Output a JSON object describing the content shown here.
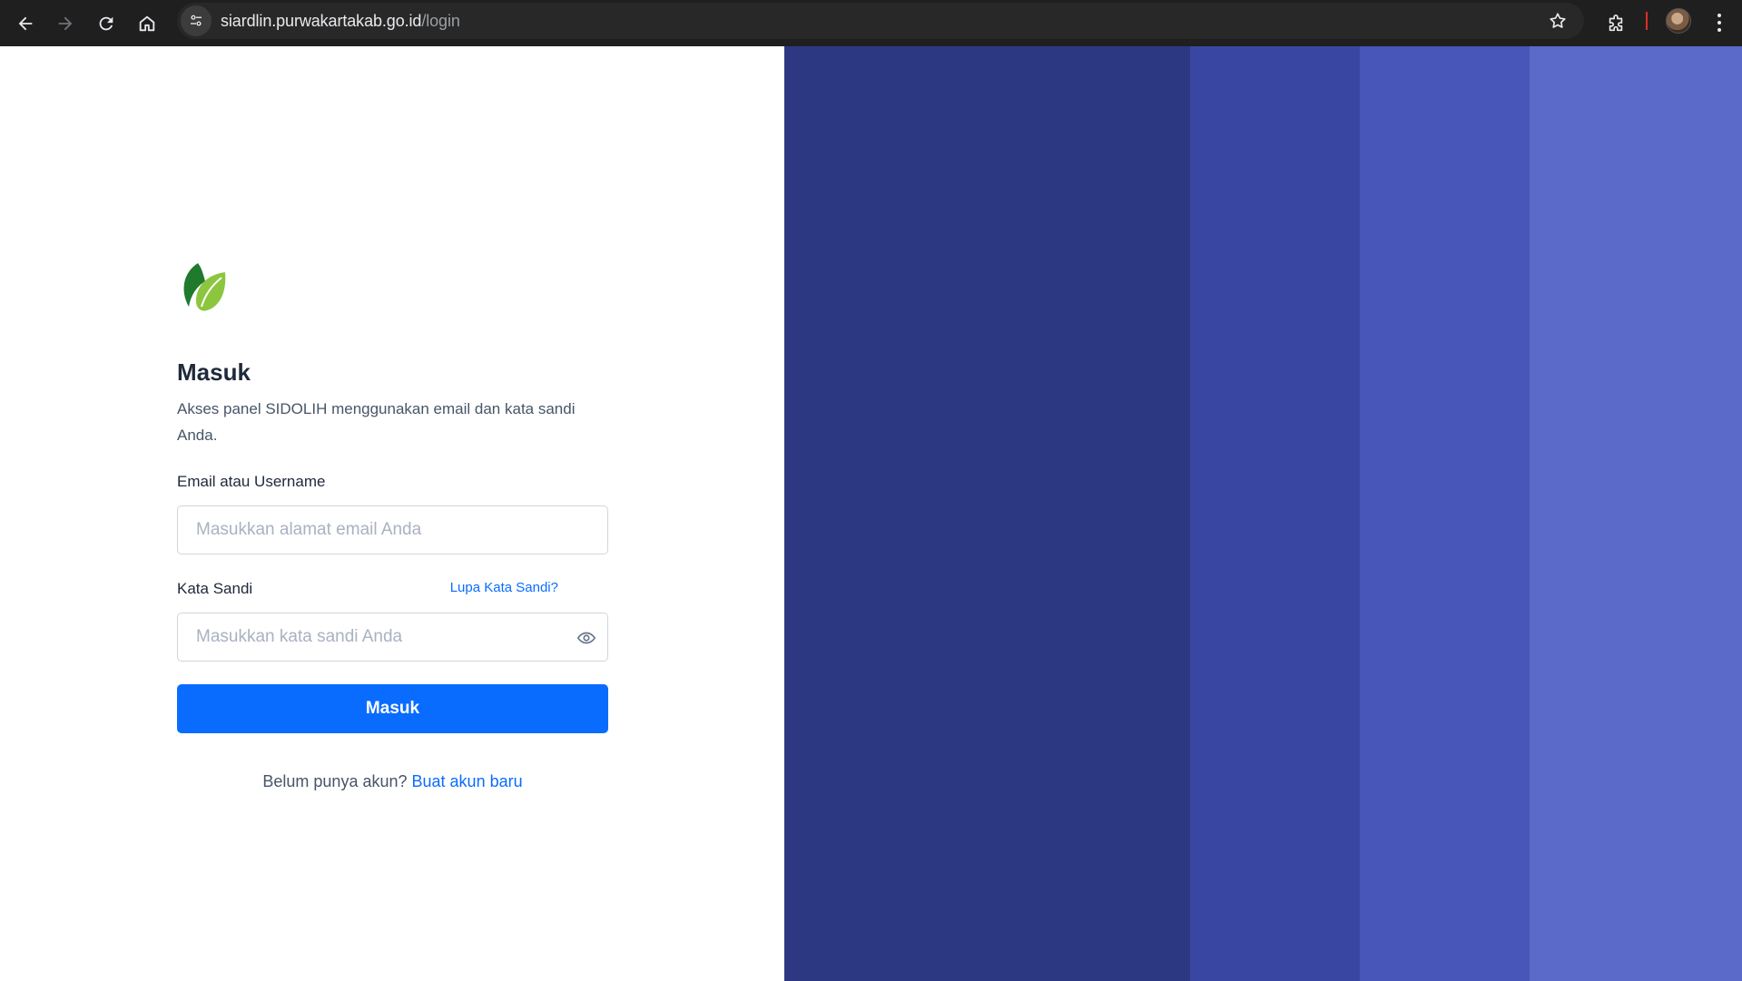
{
  "browser": {
    "url_host": "siardlin.purwakartakab.go.id",
    "url_path": "/login",
    "icons": [
      "back-icon",
      "forward-icon",
      "reload-icon",
      "home-icon",
      "site-info-icon",
      "bookmark-star-icon",
      "extensions-icon",
      "profile-avatar",
      "more-menu-icon"
    ]
  },
  "login": {
    "logo": "leaf-logo-icon",
    "title": "Masuk",
    "subtitle": "Akses panel SIDOLIH menggunakan email dan kata sandi Anda.",
    "email_label": "Email atau Username",
    "email_placeholder": "Masukkan alamat email Anda",
    "email_value": "",
    "password_label": "Kata Sandi",
    "forgot_link": "Lupa Kata Sandi?",
    "password_placeholder": "Masukkan kata sandi Anda",
    "password_value": "",
    "submit_label": "Masuk",
    "signup_prompt": "Belum punya akun?",
    "signup_link": "Buat akun baru"
  },
  "colors": {
    "primary": "#0a6cff",
    "title": "#1e293b",
    "stripes": [
      "#2d3883",
      "#3a47a2",
      "#4756b8",
      "#5b69c8"
    ]
  }
}
